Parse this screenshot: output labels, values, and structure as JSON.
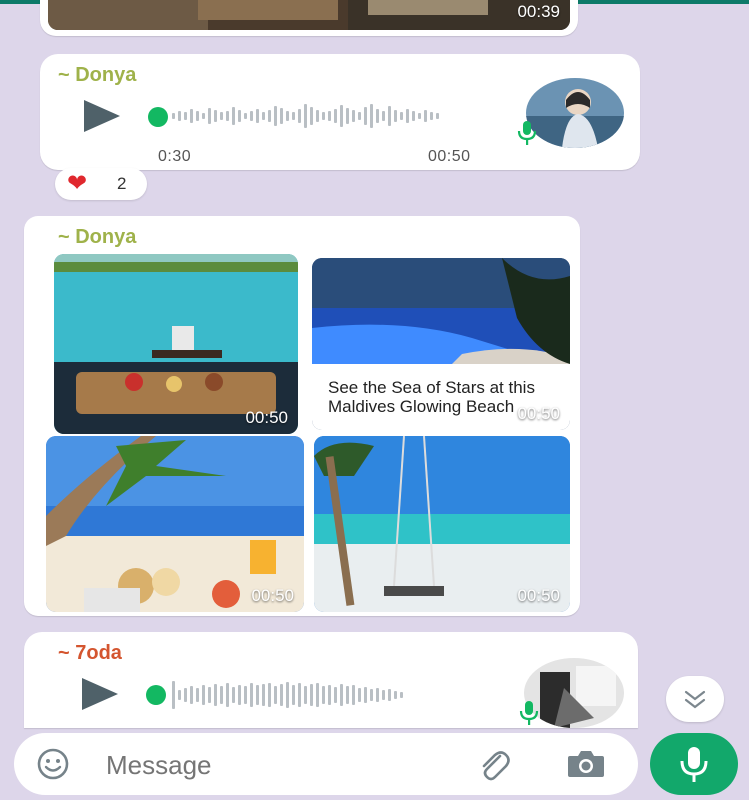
{
  "colors": {
    "accent_green": "#12a86b",
    "donya_name": "#9fb24a",
    "toda_name": "#d4552f",
    "progress_dot": "#13b862"
  },
  "top_media": {
    "duration": "00:39"
  },
  "voice_message_1": {
    "sender": "~ Donya",
    "elapsed": "0:30",
    "duration": "00:50",
    "play_icon": "play-icon",
    "mic_icon": "mic-icon"
  },
  "reaction": {
    "emoji": "❤",
    "count": "2"
  },
  "media_album": {
    "sender": "~ Donya",
    "items": [
      {
        "duration": "00:50",
        "caption": ""
      },
      {
        "duration": "00:50",
        "caption": "See the Sea of Stars at this Maldives Glowing Beach"
      },
      {
        "duration": "00:50",
        "caption": ""
      },
      {
        "duration": "00:50",
        "caption": ""
      }
    ]
  },
  "voice_message_2": {
    "sender": "~ 7oda",
    "play_icon": "play-icon",
    "mic_icon": "mic-icon"
  },
  "composer": {
    "placeholder": "Message",
    "emoji_icon": "emoji-icon",
    "attach_icon": "paperclip-icon",
    "camera_icon": "camera-icon"
  },
  "send_button": {
    "icon": "mic-icon"
  },
  "scroll_down_button": {
    "icon": "double-chevron-down-icon"
  }
}
